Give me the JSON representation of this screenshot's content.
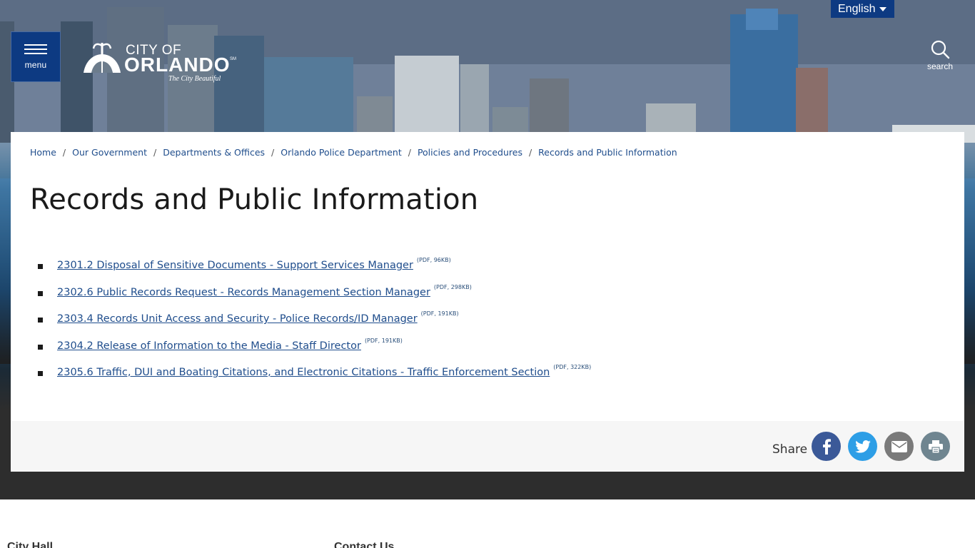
{
  "header": {
    "menu_label": "menu",
    "logo": {
      "line1": "CITY OF",
      "line2": "ORLANDO",
      "service_mark": "SM",
      "tagline": "The City Beautiful"
    },
    "language": "English",
    "search_label": "search"
  },
  "breadcrumb": [
    "Home",
    "Our Government",
    "Departments & Offices",
    "Orlando Police Department",
    "Policies and Procedures",
    "Records and Public Information"
  ],
  "page_title": "Records and Public Information",
  "documents": [
    {
      "title": "2301.2 Disposal of Sensitive Documents - Support Services Manager",
      "meta": "(PDF, 96KB)"
    },
    {
      "title": "2302.6 Public Records Request - Records Management Section Manager",
      "meta": "(PDF, 298KB)"
    },
    {
      "title": "2303.4 Records Unit Access and Security - Police Records/ID Manager",
      "meta": "(PDF, 191KB)"
    },
    {
      "title": "2304.2 Release of Information to the Media - Staff Director",
      "meta": "(PDF, 191KB)"
    },
    {
      "title": "2305.6 Traffic, DUI and Boating Citations, and Electronic Citations - Traffic Enforcement Section",
      "meta": "(PDF, 322KB)"
    }
  ],
  "share": {
    "label": "Share",
    "buttons": [
      {
        "icon": "facebook-icon",
        "color": "#3b5998"
      },
      {
        "icon": "twitter-icon",
        "color": "#2d9ee6"
      },
      {
        "icon": "email-icon",
        "color": "#7a7a7a"
      },
      {
        "icon": "print-icon",
        "color": "#6f8590"
      }
    ]
  },
  "footer": {
    "col1_heading": "City Hall",
    "col2_heading": "Contact Us"
  },
  "colors": {
    "brand_blue": "#0d3a82",
    "link": "#1f4d8c",
    "dark_band": "#2d2d2d"
  }
}
